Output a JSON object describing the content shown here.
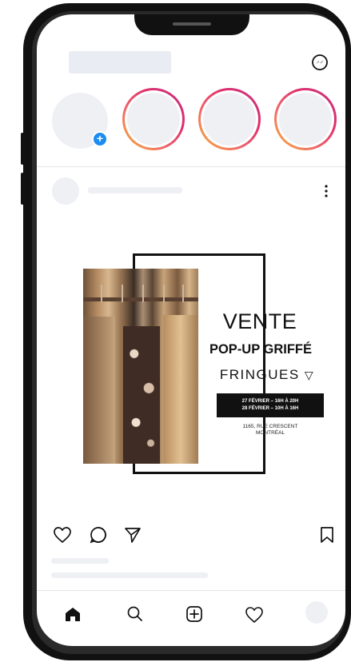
{
  "post": {
    "headline": "VENTE",
    "subheadline": "POP-UP GRIFFÉ",
    "brand": "FRINGUES",
    "brand_mark": "▽",
    "dates": [
      "27 FÉVRIER – 16H À 20H",
      "28 FÉVRIER – 10H À 16H"
    ],
    "address": [
      "1165, RUE CRESCENT",
      "MONTRÉAL"
    ]
  },
  "icons": {
    "top_right": "messenger-icon",
    "post_menu": "more-vertical-icon",
    "actions": [
      "heart-icon",
      "comment-icon",
      "share-icon"
    ],
    "save": "bookmark-icon",
    "bottom_nav": [
      "home-icon",
      "search-icon",
      "add-post-icon",
      "heart-icon",
      "profile-avatar"
    ]
  },
  "colors": {
    "story_ring_start": "#f7b733",
    "story_ring_end": "#c13584",
    "add_badge": "#1c8cf2",
    "placeholder": "#e9ecf2"
  }
}
